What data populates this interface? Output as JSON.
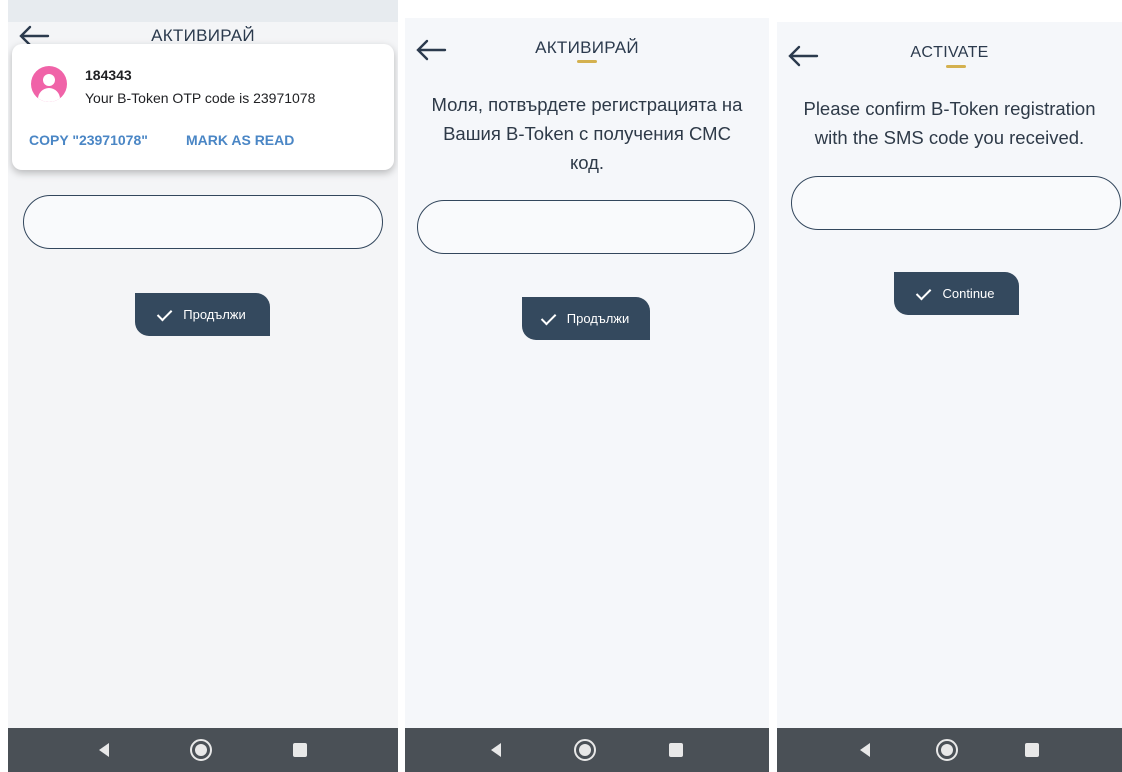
{
  "screen1": {
    "title": "АКТИВИРАЙ",
    "notification": {
      "sender": "184343",
      "message": "Your B-Token OTP code is 23971078",
      "copy_action": "COPY \"23971078\"",
      "mark_read_action": "MARK AS READ"
    },
    "input_value": "",
    "continue_label": "Продължи"
  },
  "screen2": {
    "title": "АКТИВИРАЙ",
    "intro_line1": "Моля, потвърдете регистрацията на",
    "intro_line2": "Вашия B-Token с получения СМС",
    "intro_line3": "код.",
    "input_value": "",
    "continue_label": "Продължи"
  },
  "screen3": {
    "title": "ACTIVATE",
    "intro_line1": "Please confirm B-Token registration",
    "intro_line2": "with the SMS code you received.",
    "input_value": "",
    "continue_label": "Continue"
  },
  "colors": {
    "accent_underline": "#d4b14f",
    "button_bg": "#34495e",
    "notification_avatar": "#f063a8",
    "notification_action": "#4a86c5",
    "navbar_bg": "#4a5056"
  },
  "icons": {
    "back": "arrow-left-icon",
    "check": "checkmark-icon",
    "nav_back": "triangle-back-icon",
    "nav_home": "circle-home-icon",
    "nav_recent": "square-recents-icon",
    "avatar": "person-avatar-icon"
  }
}
